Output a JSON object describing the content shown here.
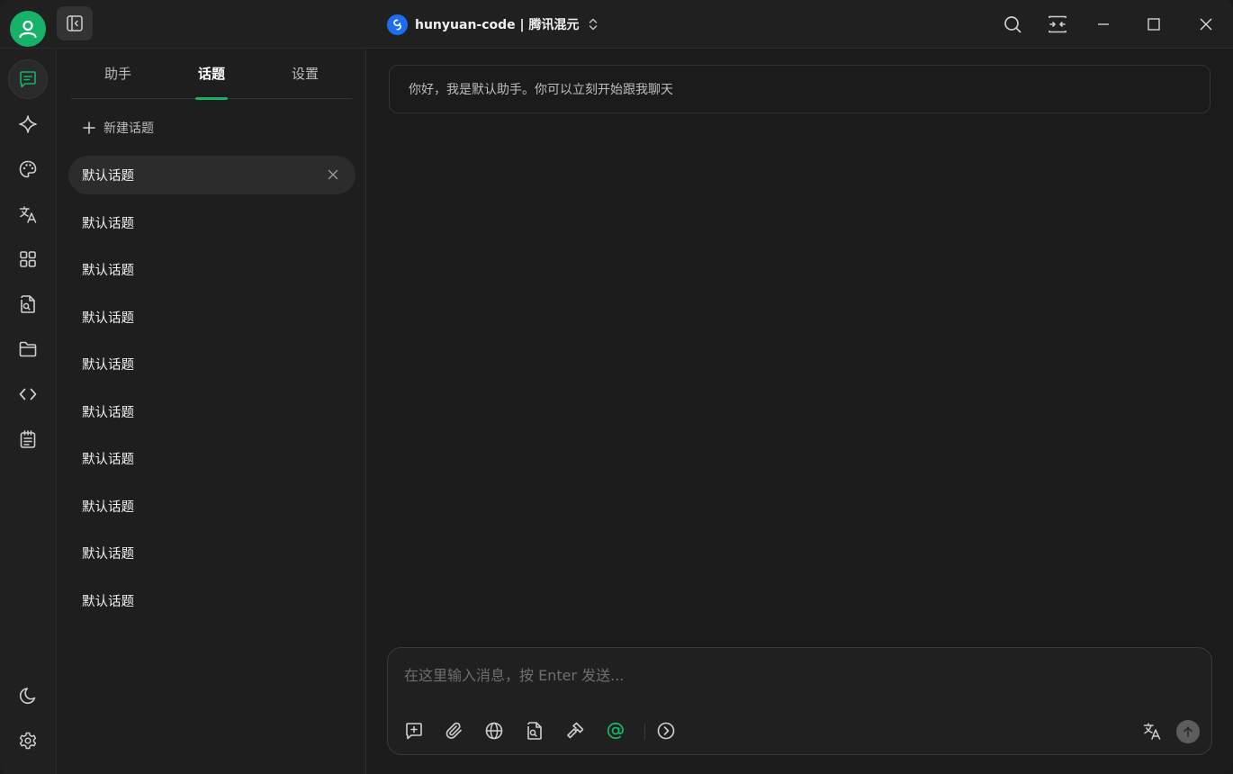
{
  "header": {
    "model_name": "hunyuan-code | 腾讯混元",
    "icons": [
      "user-avatar-icon",
      "sidebar-toggle-icon",
      "hunyuan-logo-icon",
      "chevron-updown-icon",
      "search-icon",
      "compact-view-icon",
      "minimize-icon",
      "maximize-icon",
      "close-icon"
    ]
  },
  "rail": {
    "items": [
      "chat-icon",
      "sparkle-icon",
      "palette-icon",
      "translate-icon",
      "apps-grid-icon",
      "file-search-icon",
      "folder-icon",
      "code-icon",
      "notes-icon"
    ],
    "bottom": [
      "moon-icon",
      "settings-gear-icon"
    ]
  },
  "panel": {
    "tabs": [
      {
        "label": "助手"
      },
      {
        "label": "话题",
        "active": true
      },
      {
        "label": "设置"
      }
    ],
    "new_topic_label": "新建话题",
    "topics": [
      {
        "label": "默认话题",
        "active": true
      },
      {
        "label": "默认话题"
      },
      {
        "label": "默认话题"
      },
      {
        "label": "默认话题"
      },
      {
        "label": "默认话题"
      },
      {
        "label": "默认话题"
      },
      {
        "label": "默认话题"
      },
      {
        "label": "默认话题"
      },
      {
        "label": "默认话题"
      },
      {
        "label": "默认话题"
      }
    ]
  },
  "chat": {
    "greeting": "你好，我是默认助手。你可以立刻开始跟我聊天",
    "composer_placeholder": "在这里输入消息，按 Enter 发送...",
    "toolbar": [
      "new-context-icon",
      "paperclip-icon",
      "globe-icon",
      "file-search-icon",
      "hammer-icon",
      "at-mention-icon",
      "chevron-right-circle-icon",
      "translate-icon",
      "send-arrow-icon"
    ]
  },
  "colors": {
    "accent": "#17b26a",
    "background": "#1b1b1b",
    "panel": "#1e1e1e",
    "rail": "#202020"
  }
}
